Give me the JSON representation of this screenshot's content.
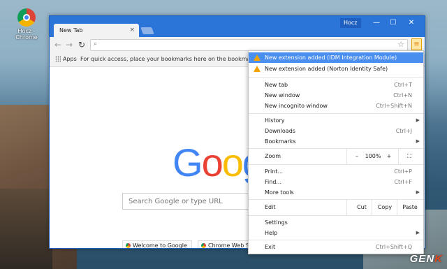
{
  "desktop": {
    "icon_label": "Hocz - Chrome",
    "watermark": {
      "main": "GEN",
      "accent": "K"
    }
  },
  "window": {
    "tab_title": "New Tab",
    "user_name": "Hocz",
    "controls": {
      "minimize": "—",
      "maximize": "☐",
      "close": "✕"
    }
  },
  "toolbar": {
    "back_icon": "←",
    "forward_icon": "→",
    "reload_icon": "↻",
    "search_icon": "🔍",
    "omnibox_value": "",
    "star_icon": "☆",
    "menu_icon": "≡"
  },
  "bookmarks_bar": {
    "apps_label": "Apps",
    "hint": "For quick access, place your bookmarks here on the bookmarks bar. Im"
  },
  "newtab": {
    "logo_letters": [
      "G",
      "o",
      "o",
      "g"
    ],
    "logo_colors": [
      "#4285f4",
      "#ea4335",
      "#fbbc05",
      "#4285f4"
    ],
    "search_placeholder": "Search Google or type URL",
    "tiles": [
      "Welcome to Google",
      "Chrome Web S"
    ]
  },
  "menu": {
    "notifications": [
      {
        "label": "New extension added (IDM Integration Module)",
        "highlighted": true
      },
      {
        "label": "New extension added (Norton Identity Safe)",
        "highlighted": false
      }
    ],
    "group1": [
      {
        "label": "New tab",
        "shortcut": "Ctrl+T"
      },
      {
        "label": "New window",
        "shortcut": "Ctrl+N"
      },
      {
        "label": "New incognito window",
        "shortcut": "Ctrl+Shift+N"
      }
    ],
    "group2": [
      {
        "label": "History",
        "shortcut": "",
        "submenu": true
      },
      {
        "label": "Downloads",
        "shortcut": "Ctrl+J",
        "submenu": false
      },
      {
        "label": "Bookmarks",
        "shortcut": "",
        "submenu": true
      }
    ],
    "zoom": {
      "label": "Zoom",
      "minus": "–",
      "value": "100%",
      "plus": "+",
      "fullscreen": "⛶"
    },
    "group3": [
      {
        "label": "Print...",
        "shortcut": "Ctrl+P",
        "submenu": false
      },
      {
        "label": "Find...",
        "shortcut": "Ctrl+F",
        "submenu": false
      },
      {
        "label": "More tools",
        "shortcut": "",
        "submenu": true
      }
    ],
    "edit": {
      "label": "Edit",
      "cut": "Cut",
      "copy": "Copy",
      "paste": "Paste"
    },
    "group4": [
      {
        "label": "Settings",
        "shortcut": "",
        "submenu": false
      },
      {
        "label": "Help",
        "shortcut": "",
        "submenu": true
      }
    ],
    "exit": {
      "label": "Exit",
      "shortcut": "Ctrl+Shift+Q"
    },
    "submenu_arrow": "▶"
  }
}
